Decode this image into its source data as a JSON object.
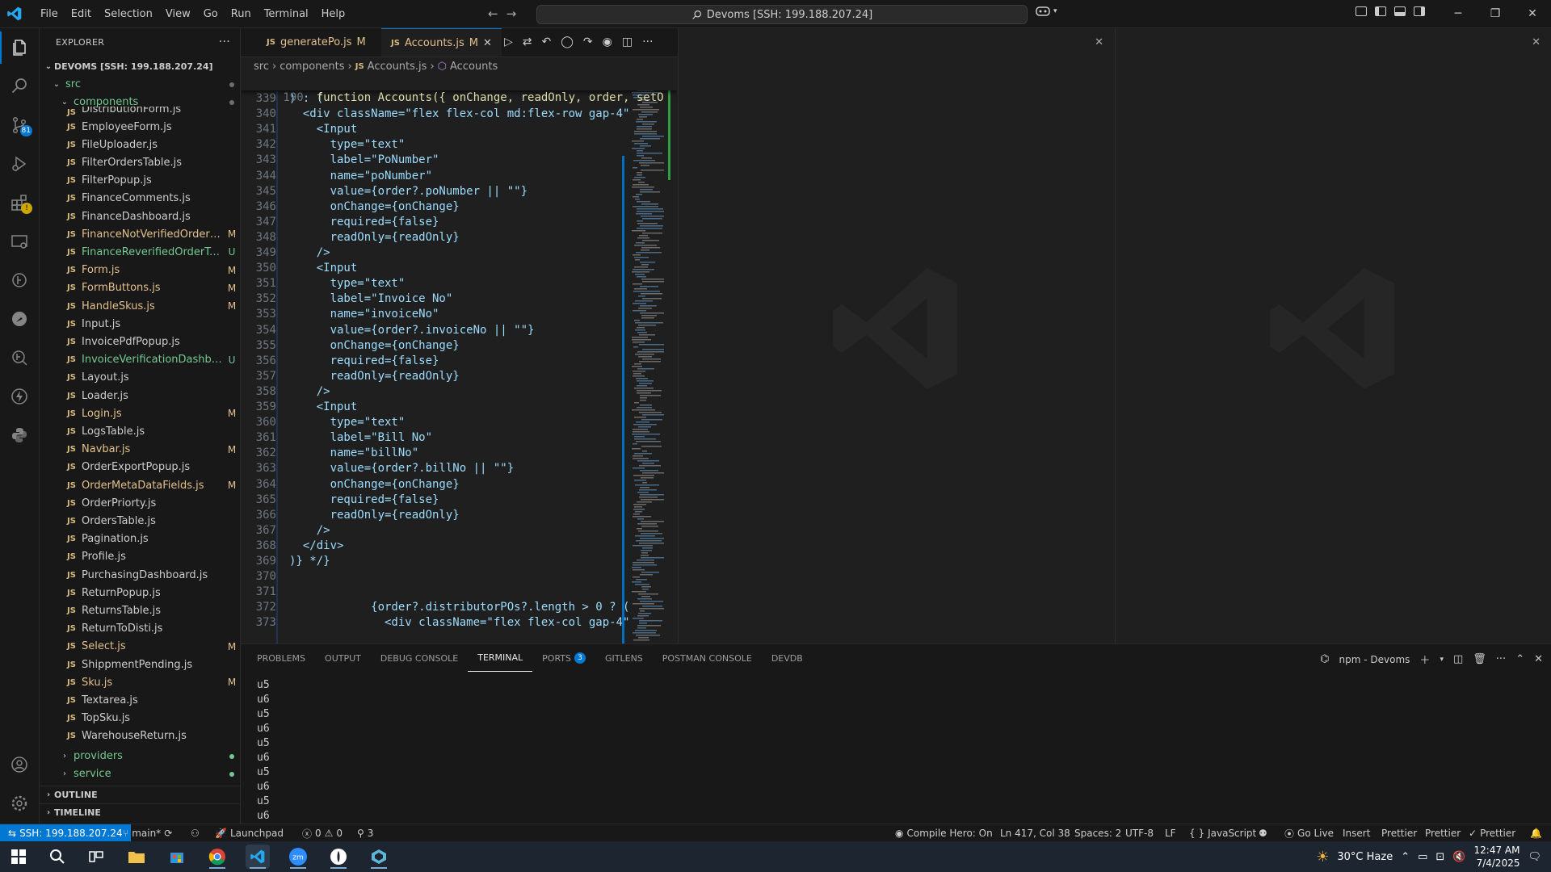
{
  "menu": [
    "File",
    "Edit",
    "Selection",
    "View",
    "Go",
    "Run",
    "Terminal",
    "Help"
  ],
  "command_center": "Devoms [SSH: 199.188.207.24]",
  "explorer": {
    "title": "EXPLORER",
    "workspace": "DEVOMS [SSH: 199.188.207.24]",
    "src_label": "src",
    "components_label": "components",
    "partial_top": "DistributionForm.js",
    "files": [
      {
        "name": "EmployeeForm.js",
        "status": ""
      },
      {
        "name": "FileUploader.js",
        "status": ""
      },
      {
        "name": "FilterOrdersTable.js",
        "status": ""
      },
      {
        "name": "FilterPopup.js",
        "status": ""
      },
      {
        "name": "FinanceComments.js",
        "status": ""
      },
      {
        "name": "FinanceDashboard.js",
        "status": ""
      },
      {
        "name": "FinanceNotVerifiedOrderTa...",
        "status": "M"
      },
      {
        "name": "FinanceReverifiedOrderTabl...",
        "status": "U"
      },
      {
        "name": "Form.js",
        "status": "M"
      },
      {
        "name": "FormButtons.js",
        "status": "M"
      },
      {
        "name": "HandleSkus.js",
        "status": "M"
      },
      {
        "name": "Input.js",
        "status": ""
      },
      {
        "name": "InvoicePdfPopup.js",
        "status": ""
      },
      {
        "name": "InvoiceVerificationDashboa...",
        "status": "U"
      },
      {
        "name": "Layout.js",
        "status": ""
      },
      {
        "name": "Loader.js",
        "status": ""
      },
      {
        "name": "Login.js",
        "status": "M"
      },
      {
        "name": "LogsTable.js",
        "status": ""
      },
      {
        "name": "Navbar.js",
        "status": "M"
      },
      {
        "name": "OrderExportPopup.js",
        "status": ""
      },
      {
        "name": "OrderMetaDataFields.js",
        "status": "M"
      },
      {
        "name": "OrderPriorty.js",
        "status": ""
      },
      {
        "name": "OrdersTable.js",
        "status": ""
      },
      {
        "name": "Pagination.js",
        "status": ""
      },
      {
        "name": "Profile.js",
        "status": ""
      },
      {
        "name": "PurchasingDashboard.js",
        "status": ""
      },
      {
        "name": "ReturnPopup.js",
        "status": ""
      },
      {
        "name": "ReturnsTable.js",
        "status": ""
      },
      {
        "name": "ReturnToDisti.js",
        "status": ""
      },
      {
        "name": "Select.js",
        "status": "M"
      },
      {
        "name": "ShippmentPending.js",
        "status": ""
      },
      {
        "name": "Sku.js",
        "status": "M"
      },
      {
        "name": "Textarea.js",
        "status": ""
      },
      {
        "name": "TopSku.js",
        "status": ""
      },
      {
        "name": "WarehouseReturn.js",
        "status": ""
      }
    ],
    "providers_label": "providers",
    "service_label": "service",
    "outline_label": "OUTLINE",
    "timeline_label": "TIMELINE"
  },
  "tabs": [
    {
      "label": "generatePo.js",
      "status": "M"
    },
    {
      "label": "Accounts.js",
      "status": "M"
    }
  ],
  "breadcrumb": [
    "src",
    "components",
    "Accounts.js",
    "Accounts"
  ],
  "code": {
    "sticky_ln": "190",
    "sticky_text": "function Accounts({ onChange, readOnly, order, setO",
    "lines": [
      {
        "ln": "339",
        "t": ") : ("
      },
      {
        "ln": "340",
        "t": "  <div className=\"flex flex-col md:flex-row gap-4\">"
      },
      {
        "ln": "341",
        "t": "    <Input"
      },
      {
        "ln": "342",
        "t": "      type=\"text\""
      },
      {
        "ln": "343",
        "t": "      label=\"PoNumber\""
      },
      {
        "ln": "344",
        "t": "      name=\"poNumber\""
      },
      {
        "ln": "345",
        "t": "      value={order?.poNumber || \"\"}"
      },
      {
        "ln": "346",
        "t": "      onChange={onChange}"
      },
      {
        "ln": "347",
        "t": "      required={false}"
      },
      {
        "ln": "348",
        "t": "      readOnly={readOnly}"
      },
      {
        "ln": "349",
        "t": "    />"
      },
      {
        "ln": "350",
        "t": "    <Input"
      },
      {
        "ln": "351",
        "t": "      type=\"text\""
      },
      {
        "ln": "352",
        "t": "      label=\"Invoice No\""
      },
      {
        "ln": "353",
        "t": "      name=\"invoiceNo\""
      },
      {
        "ln": "354",
        "t": "      value={order?.invoiceNo || \"\"}"
      },
      {
        "ln": "355",
        "t": "      onChange={onChange}"
      },
      {
        "ln": "356",
        "t": "      required={false}"
      },
      {
        "ln": "357",
        "t": "      readOnly={readOnly}"
      },
      {
        "ln": "358",
        "t": "    />"
      },
      {
        "ln": "359",
        "t": "    <Input"
      },
      {
        "ln": "360",
        "t": "      type=\"text\""
      },
      {
        "ln": "361",
        "t": "      label=\"Bill No\""
      },
      {
        "ln": "362",
        "t": "      name=\"billNo\""
      },
      {
        "ln": "363",
        "t": "      value={order?.billNo || \"\"}"
      },
      {
        "ln": "364",
        "t": "      onChange={onChange}"
      },
      {
        "ln": "365",
        "t": "      required={false}"
      },
      {
        "ln": "366",
        "t": "      readOnly={readOnly}"
      },
      {
        "ln": "367",
        "t": "    />"
      },
      {
        "ln": "368",
        "t": "  </div>"
      },
      {
        "ln": "369",
        "t": ")} */}"
      },
      {
        "ln": "370",
        "t": ""
      },
      {
        "ln": "371",
        "t": ""
      },
      {
        "ln": "372",
        "t": "            {order?.distributorPOs?.length > 0 ? ("
      },
      {
        "ln": "373",
        "t": "              <div className=\"flex flex-col gap-4\">"
      }
    ]
  },
  "panel": {
    "tabs": [
      {
        "label": "PROBLEMS",
        "badge": ""
      },
      {
        "label": "OUTPUT",
        "badge": ""
      },
      {
        "label": "DEBUG CONSOLE",
        "badge": ""
      },
      {
        "label": "TERMINAL",
        "badge": ""
      },
      {
        "label": "PORTS",
        "badge": "3"
      },
      {
        "label": "GITLENS",
        "badge": ""
      },
      {
        "label": "POSTMAN CONSOLE",
        "badge": ""
      },
      {
        "label": "DEVDB",
        "badge": ""
      }
    ],
    "active_tab": "TERMINAL",
    "terminal_name": "npm - Devoms",
    "terminal_lines": [
      "u5",
      "u6",
      "u5",
      "u6",
      "u5",
      "u6",
      "u5",
      "u6",
      "u5",
      "u6"
    ]
  },
  "status": {
    "remote": "SSH: 199.188.207.24",
    "branch": "main*",
    "launchpad": "Launchpad",
    "errors": "0",
    "warnings": "0",
    "ports": "3",
    "compile_hero": "Compile Hero: On",
    "position": "Ln 417, Col 38",
    "spaces": "Spaces: 2",
    "encoding": "UTF-8",
    "eol": "LF",
    "language": "JavaScript",
    "go_live": "Go Live",
    "insert": "Insert",
    "prettier1": "Prettier",
    "prettier2": "Prettier",
    "prettier3": "Prettier"
  },
  "activity_badges": {
    "scm": "81"
  },
  "taskbar": {
    "weather": "30°C  Haze",
    "time": "12:47 AM",
    "date": "7/4/2025"
  },
  "colors": {
    "accent": "#0078d4",
    "modified": "#e2c08d",
    "untracked": "#73c991"
  }
}
